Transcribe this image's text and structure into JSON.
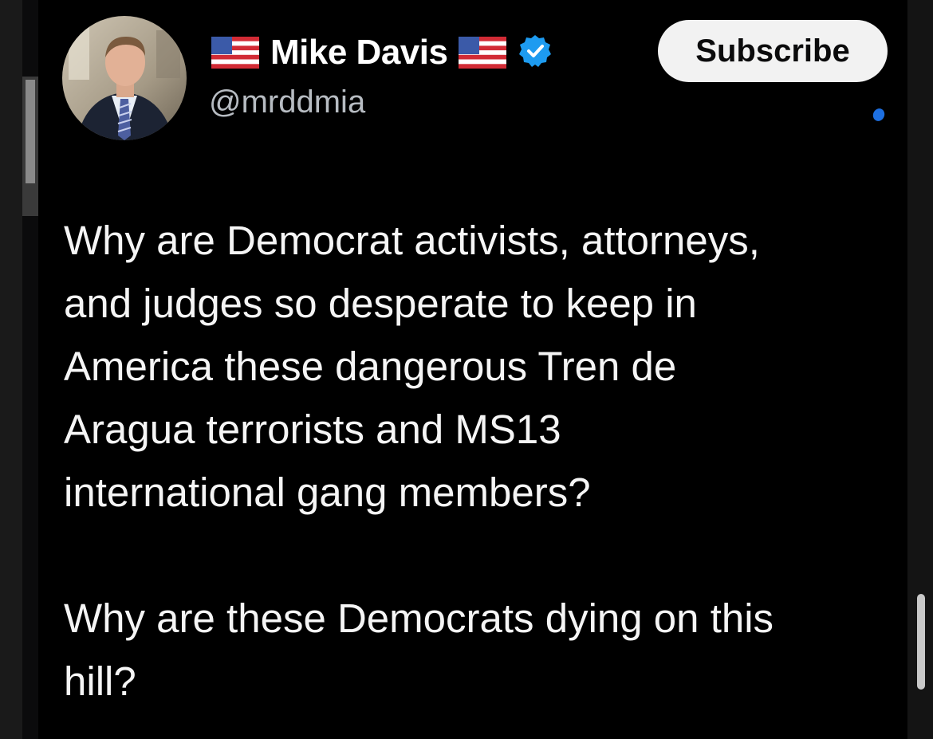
{
  "post": {
    "author": {
      "display_name": "Mike Davis",
      "handle": "@mrddmia",
      "verified": true,
      "flag_icon": "us-flag-icon",
      "verified_icon": "verified-badge-icon"
    },
    "subscribe_label": "Subscribe",
    "text": {
      "paragraph_1": "Why are Democrat activists, attorneys,\nand judges so desperate to keep in\nAmerica these dangerous Tren de\nAragua terrorists and MS13\ninternational gang members?",
      "paragraph_2": "Why are these Democrats dying on this\nhill?"
    }
  },
  "colors": {
    "background": "#000000",
    "text": "#f5f5f5",
    "handle": "#b7bcc2",
    "verified_blue": "#1d9bf0",
    "button_bg": "#f2f2f2"
  }
}
